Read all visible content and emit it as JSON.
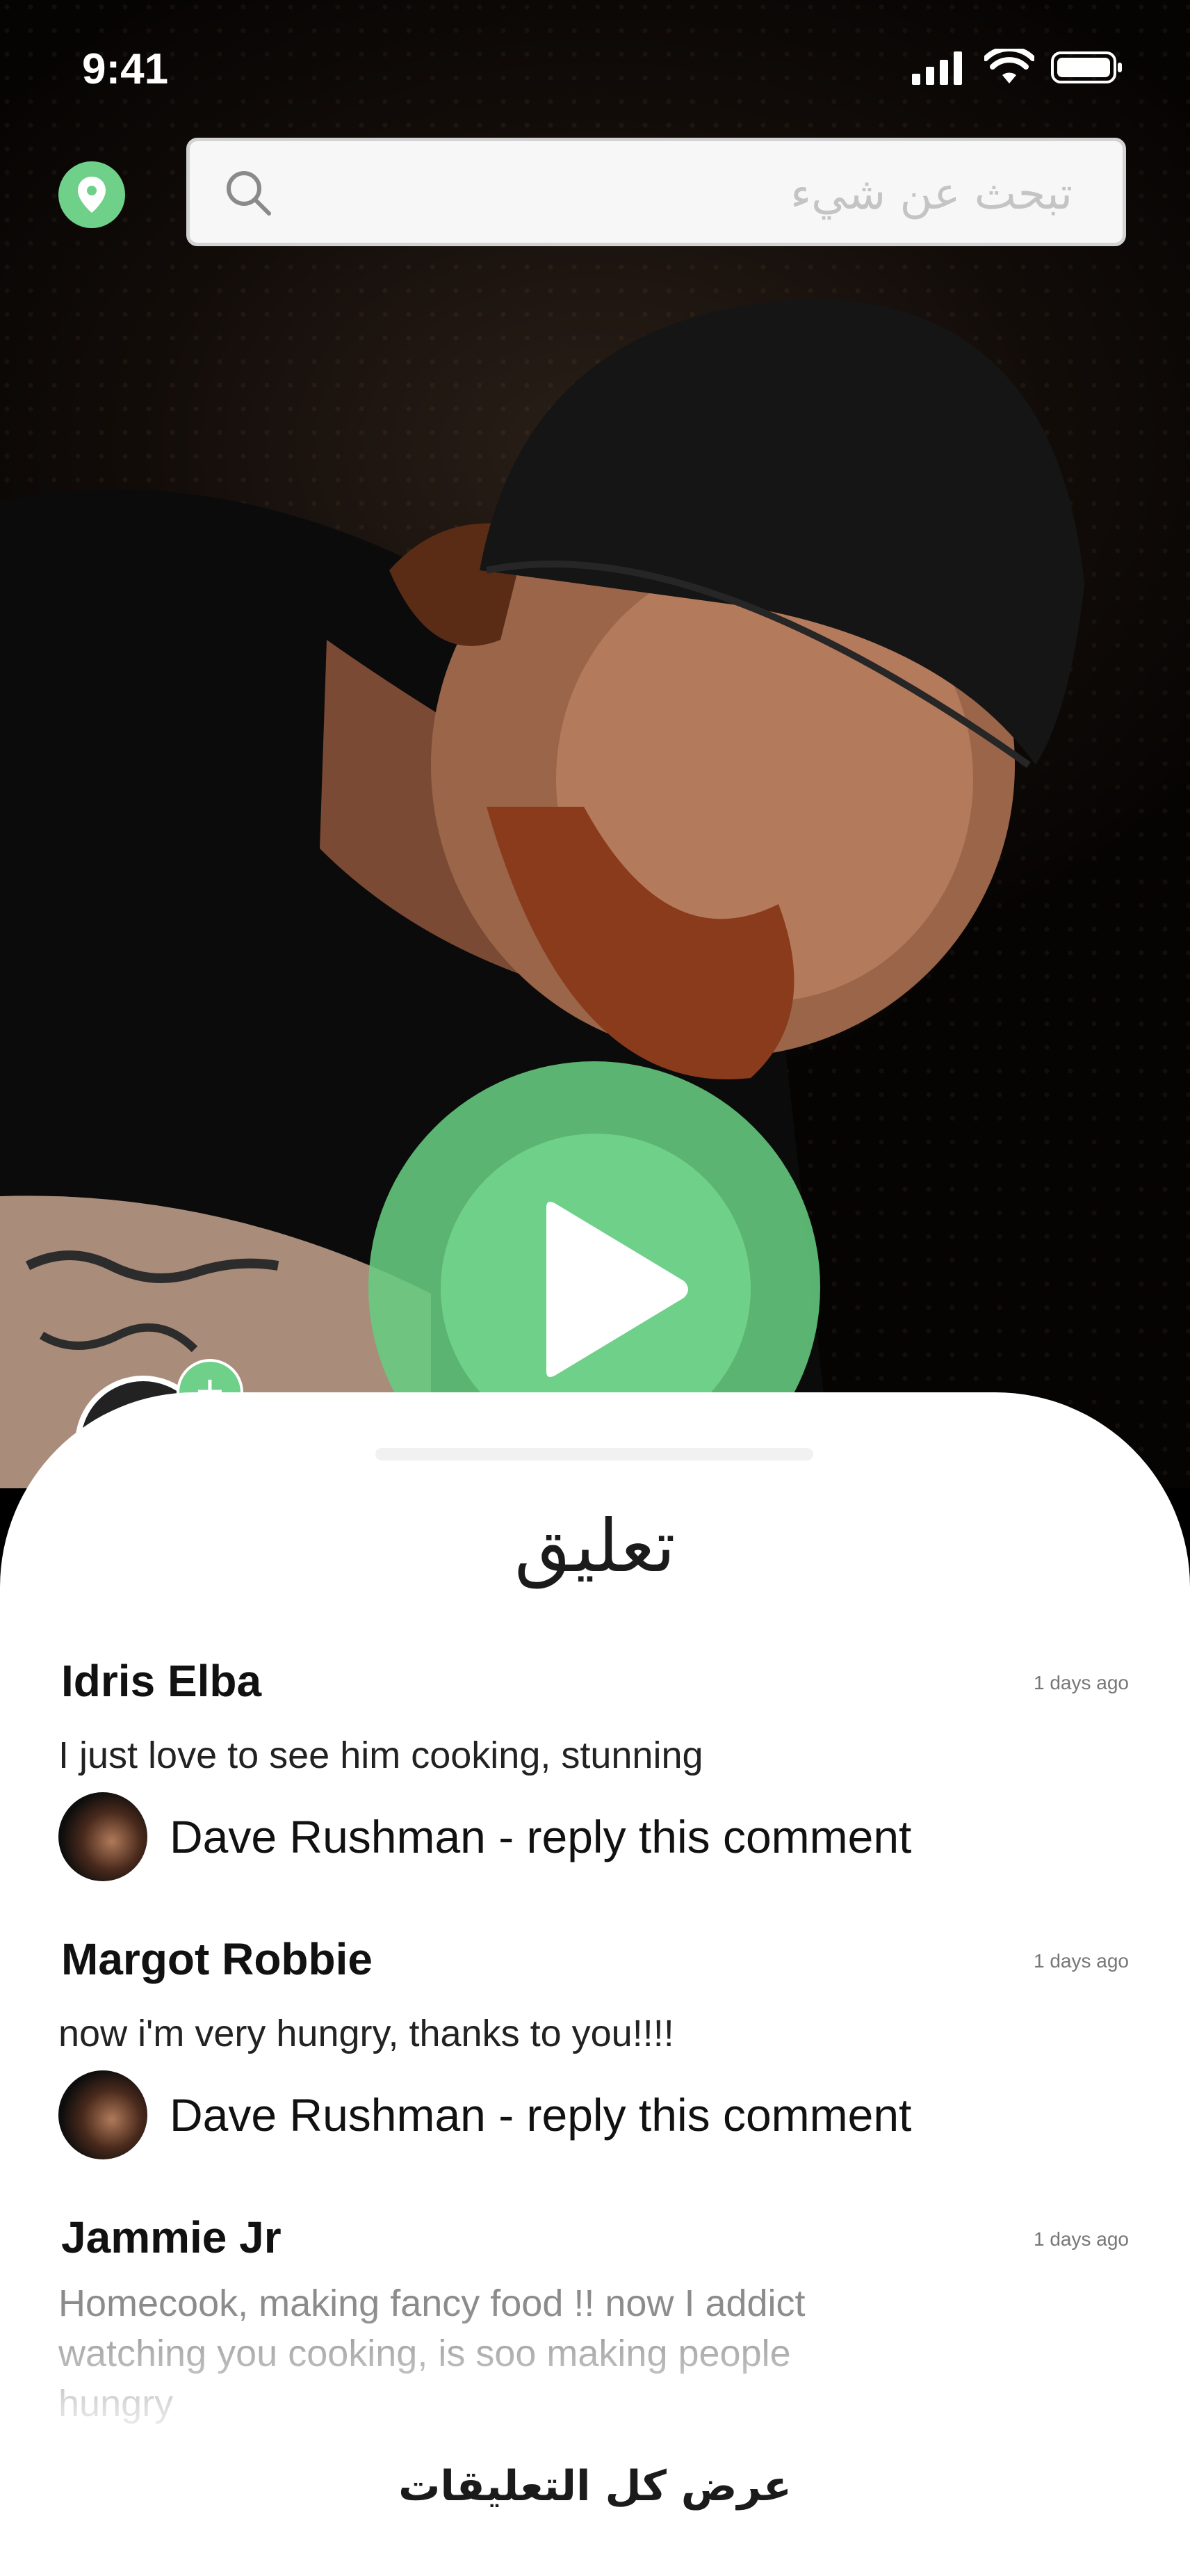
{
  "status_bar": {
    "time": "9:41"
  },
  "search": {
    "placeholder": "تبحث عن شيء"
  },
  "sheet": {
    "title": "تعليق",
    "view_all": "عرض كل التعليقات"
  },
  "comments": [
    {
      "name": "Idris Elba",
      "time": "1 days ago",
      "text": "I just love to see him cooking, stunning",
      "reply": "Dave Rushman - reply this comment"
    },
    {
      "name": "Margot Robbie",
      "time": "1 days ago",
      "text": "now i'm very hungry, thanks to you!!!!",
      "reply": "Dave Rushman - reply this comment"
    },
    {
      "name": "Jammie Jr",
      "time": "1 days ago",
      "text": "Homecook, making fancy food !! now I addict watching you cooking, is soo making people hungry"
    }
  ],
  "colors": {
    "accent": "#6fd08a",
    "sheet": "#ffffff"
  },
  "icons": [
    "location-pin-icon",
    "search-icon",
    "play-icon",
    "signal-icon",
    "wifi-icon",
    "battery-icon",
    "plus-icon"
  ]
}
